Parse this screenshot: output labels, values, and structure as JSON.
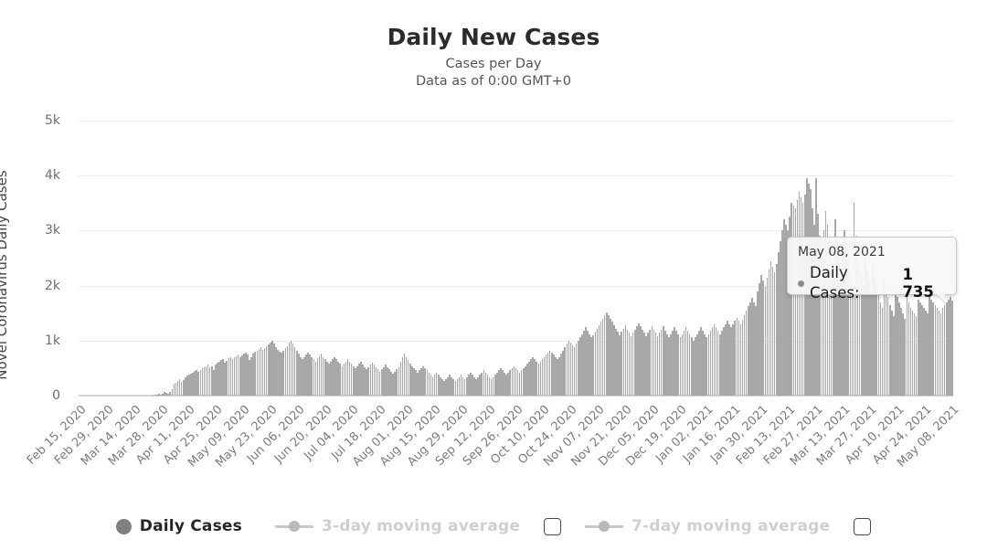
{
  "header": {
    "title": "Daily New Cases",
    "subtitle": "Cases per Day",
    "subtitle2": "Data as of 0:00 GMT+0"
  },
  "tooltip": {
    "date": "May 08, 2021",
    "series_label": "Daily Cases:",
    "value": "1 735",
    "marker_color": "#8c8c8c"
  },
  "legend": {
    "items": [
      {
        "label": "Daily Cases",
        "marker": "dot",
        "active": true,
        "checkbox": false
      },
      {
        "label": "3-day moving average",
        "marker": "line-point",
        "active": false,
        "checkbox": true
      },
      {
        "label": "7-day moving average",
        "marker": "line-point",
        "active": false,
        "checkbox": true
      }
    ]
  },
  "chart_data": {
    "type": "bar",
    "title": "Daily New Cases",
    "subtitle": "Cases per Day",
    "xlabel": "",
    "ylabel": "Novel Coronavirus Daily Cases",
    "ylim": [
      0,
      5000
    ],
    "yticks": [
      0,
      1000,
      2000,
      3000,
      4000,
      5000
    ],
    "ytick_labels": [
      "0",
      "1k",
      "2k",
      "3k",
      "4k",
      "5k"
    ],
    "grid": true,
    "legend_position": "bottom",
    "bar_color": "#a8a8a8",
    "series_name": "Daily Cases",
    "x_start": "2020-02-15",
    "x_end": "2021-05-08",
    "xtick_labels": [
      "Feb 15, 2020",
      "Feb 29, 2020",
      "Mar 14, 2020",
      "Mar 28, 2020",
      "Apr 11, 2020",
      "Apr 25, 2020",
      "May 09, 2020",
      "May 23, 2020",
      "Jun 06, 2020",
      "Jun 20, 2020",
      "Jul 04, 2020",
      "Jul 18, 2020",
      "Aug 01, 2020",
      "Aug 15, 2020",
      "Aug 29, 2020",
      "Sep 12, 2020",
      "Sep 26, 2020",
      "Oct 10, 2020",
      "Oct 24, 2020",
      "Nov 07, 2020",
      "Nov 21, 2020",
      "Dec 05, 2020",
      "Dec 19, 2020",
      "Jan 02, 2021",
      "Jan 16, 2021",
      "Jan 30, 2021",
      "Feb 13, 2021",
      "Feb 27, 2021",
      "Mar 13, 2021",
      "Mar 27, 2021",
      "Apr 10, 2021",
      "Apr 24, 2021",
      "May 08, 2021"
    ],
    "xtick_interval_days": 14,
    "values": [
      0,
      0,
      0,
      0,
      0,
      0,
      0,
      0,
      0,
      0,
      0,
      0,
      0,
      0,
      0,
      0,
      0,
      0,
      0,
      0,
      0,
      0,
      0,
      0,
      0,
      0,
      0,
      0,
      0,
      0,
      0,
      0,
      0,
      0,
      0,
      0,
      0,
      0,
      0,
      5,
      12,
      18,
      30,
      25,
      40,
      60,
      55,
      35,
      70,
      120,
      210,
      240,
      270,
      300,
      250,
      290,
      330,
      360,
      380,
      400,
      420,
      450,
      470,
      430,
      460,
      500,
      520,
      540,
      560,
      510,
      530,
      470,
      560,
      600,
      620,
      640,
      660,
      600,
      630,
      680,
      700,
      660,
      690,
      720,
      740,
      700,
      730,
      760,
      780,
      740,
      640,
      700,
      760,
      800,
      820,
      850,
      880,
      830,
      870,
      900,
      930,
      960,
      990,
      940,
      880,
      830,
      800,
      780,
      820,
      860,
      900,
      960,
      1000,
      940,
      880,
      820,
      760,
      700,
      660,
      700,
      740,
      780,
      740,
      700,
      660,
      620,
      680,
      720,
      760,
      700,
      660,
      620,
      580,
      620,
      660,
      700,
      660,
      620,
      580,
      540,
      580,
      620,
      660,
      620,
      580,
      540,
      500,
      540,
      580,
      620,
      560,
      520,
      480,
      520,
      560,
      600,
      560,
      520,
      480,
      440,
      480,
      520,
      560,
      520,
      480,
      440,
      400,
      440,
      480,
      520,
      620,
      700,
      760,
      700,
      640,
      580,
      540,
      500,
      460,
      420,
      460,
      500,
      540,
      500,
      460,
      420,
      380,
      340,
      380,
      420,
      380,
      340,
      300,
      260,
      300,
      340,
      380,
      340,
      300,
      260,
      300,
      340,
      380,
      340,
      300,
      340,
      380,
      420,
      380,
      340,
      300,
      340,
      380,
      420,
      460,
      420,
      380,
      340,
      300,
      340,
      380,
      420,
      460,
      500,
      460,
      420,
      380,
      420,
      460,
      500,
      540,
      500,
      460,
      420,
      460,
      500,
      540,
      580,
      620,
      660,
      700,
      660,
      620,
      580,
      620,
      660,
      700,
      740,
      780,
      820,
      780,
      740,
      700,
      660,
      700,
      760,
      820,
      880,
      940,
      1000,
      960,
      920,
      880,
      940,
      1000,
      1060,
      1120,
      1180,
      1240,
      1180,
      1120,
      1060,
      1100,
      1160,
      1220,
      1280,
      1340,
      1400,
      1460,
      1520,
      1460,
      1400,
      1340,
      1280,
      1220,
      1160,
      1100,
      1160,
      1220,
      1280,
      1200,
      1140,
      1080,
      1140,
      1200,
      1260,
      1320,
      1260,
      1200,
      1140,
      1080,
      1140,
      1200,
      1260,
      1200,
      1140,
      1080,
      1140,
      1200,
      1260,
      1180,
      1120,
      1060,
      1120,
      1180,
      1240,
      1180,
      1120,
      1060,
      1120,
      1180,
      1240,
      1180,
      1120,
      1060,
      1000,
      1060,
      1120,
      1180,
      1240,
      1180,
      1120,
      1060,
      1120,
      1180,
      1240,
      1300,
      1240,
      1180,
      1120,
      1180,
      1240,
      1300,
      1360,
      1300,
      1240,
      1300,
      1360,
      1420,
      1360,
      1300,
      1380,
      1460,
      1540,
      1620,
      1700,
      1780,
      1700,
      1620,
      1900,
      2050,
      2200,
      2100,
      2000,
      2150,
      2300,
      2450,
      2350,
      2250,
      2400,
      2600,
      2800,
      3000,
      3200,
      3100,
      3000,
      3250,
      3500,
      3450,
      3400,
      3550,
      3700,
      3600,
      3500,
      3650,
      3950,
      3850,
      3750,
      3400,
      3100,
      3950,
      3300,
      2900,
      2600,
      3000,
      3350,
      3100,
      2850,
      2600,
      2400,
      3200,
      2700,
      2500,
      2300,
      2700,
      3000,
      2800,
      2500,
      2300,
      2100,
      3500,
      2900,
      2600,
      2400,
      2200,
      2000,
      2500,
      2300,
      2100,
      1900,
      2400,
      2200,
      2000,
      1850,
      1700,
      1600,
      2100,
      1950,
      1800,
      1650,
      1550,
      1450,
      1900,
      1800,
      1700,
      1600,
      1500,
      1400,
      1800,
      1700,
      1600,
      1550,
      1500,
      1450,
      1750,
      1700,
      1650,
      1600,
      1550,
      1500,
      1800,
      1750,
      1700,
      1650,
      1600,
      1550,
      1500,
      1600,
      1650,
      1700,
      1750,
      1800,
      1735
    ]
  }
}
